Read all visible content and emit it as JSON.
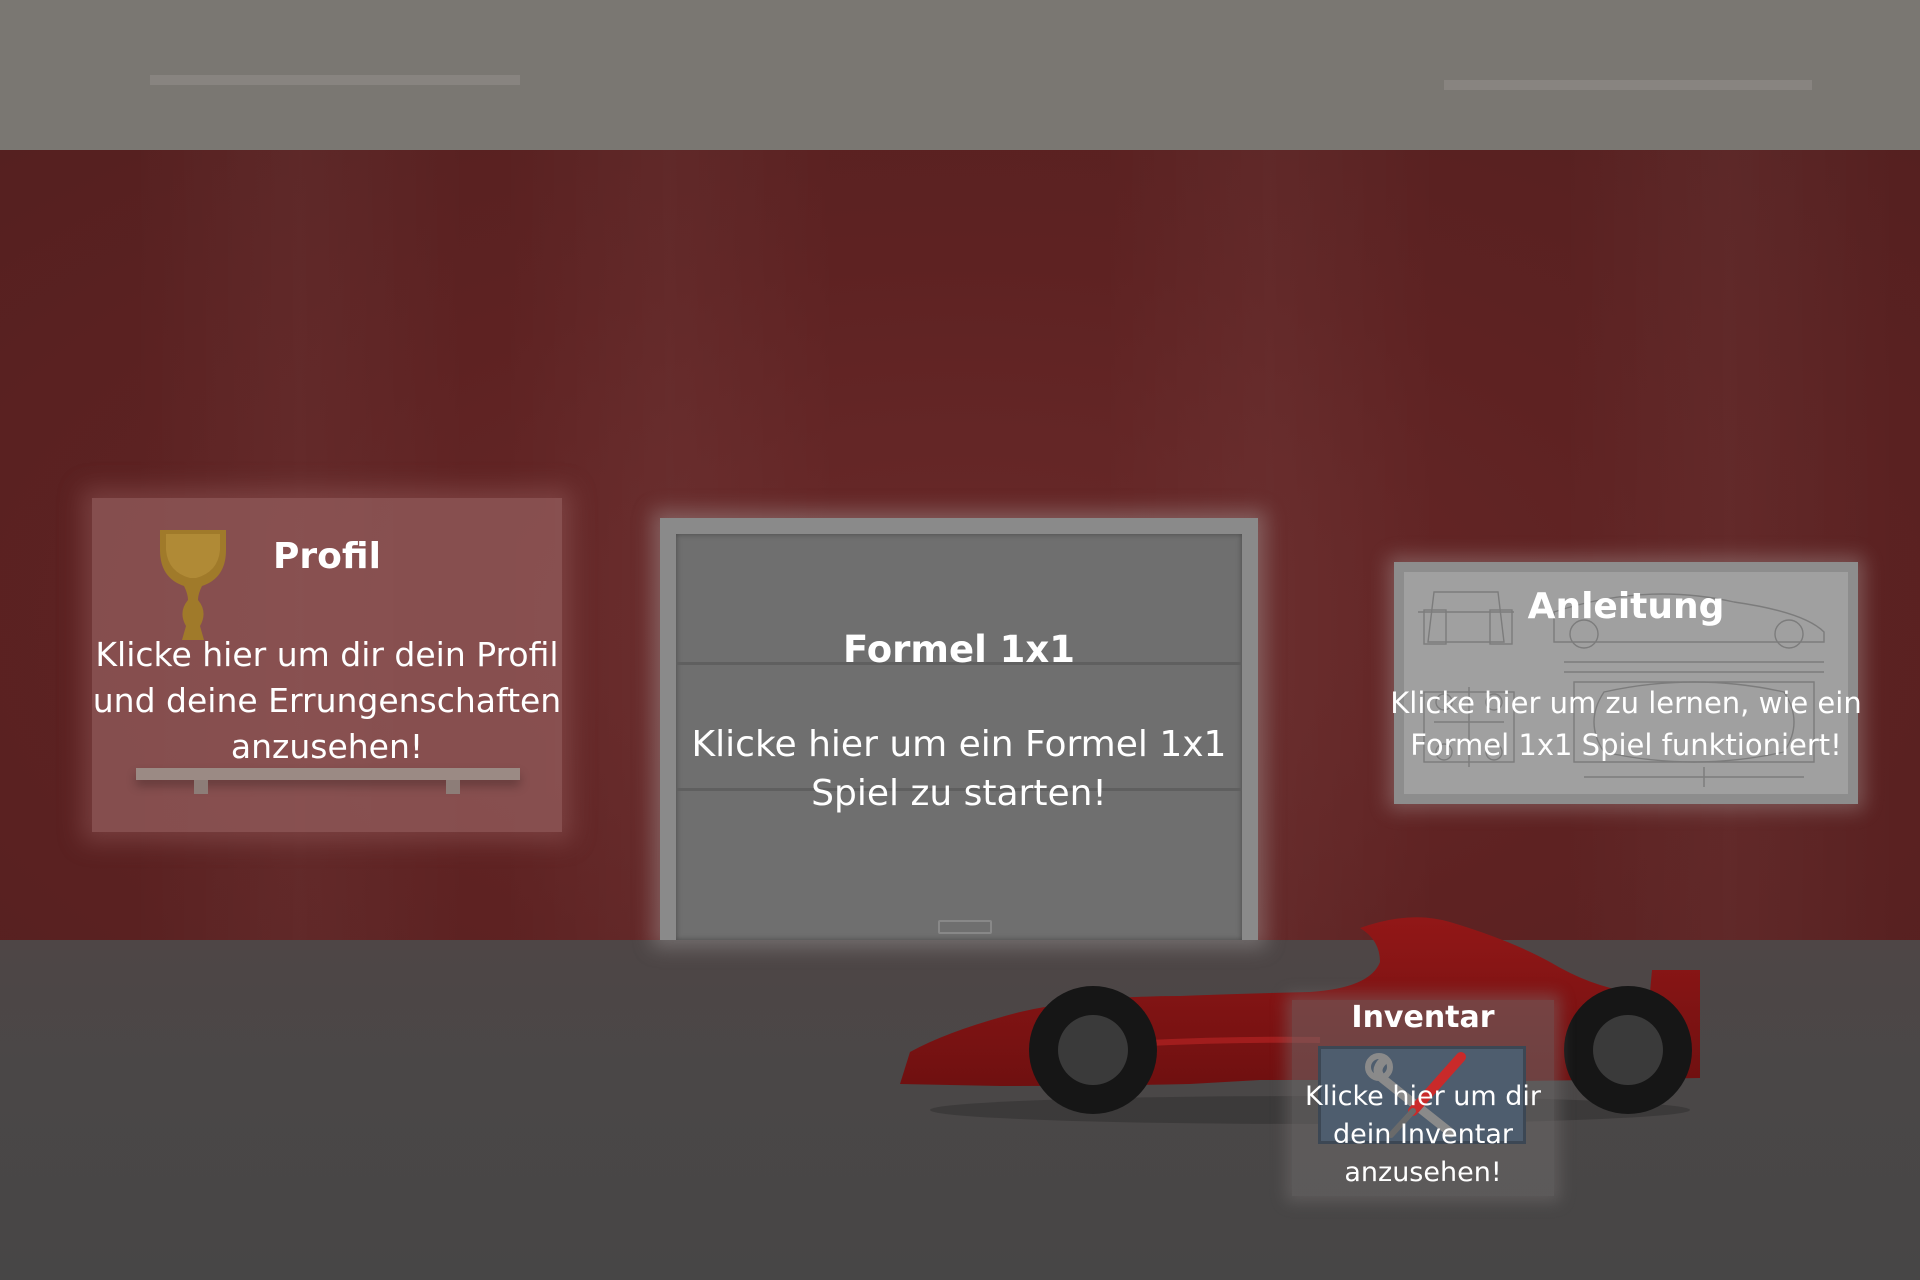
{
  "profil": {
    "title": "Profil",
    "description": "Klicke hier um dir dein Profil und deine Errungenschaften anzusehen!"
  },
  "formel": {
    "title": "Formel 1x1",
    "description": "Klicke hier um ein Formel 1x1 Spiel zu starten!"
  },
  "anleitung": {
    "title": "Anleitung",
    "description": "Klicke hier um zu lernen, wie ein Formel 1x1 Spiel funktioniert!"
  },
  "inventar": {
    "title": "Inventar",
    "description": "Klicke hier um dir dein Inventar anzusehen!"
  },
  "colors": {
    "wall": "#5e2222",
    "floor": "#4a4747",
    "ceiling": "#7a7772",
    "car": "#8b1414",
    "trophy": "#a07a2a"
  },
  "icons": {
    "profil": "trophy-icon",
    "anleitung": "blueprint-icon",
    "inventar": "tools-icon",
    "formel": "garage-door-icon"
  }
}
